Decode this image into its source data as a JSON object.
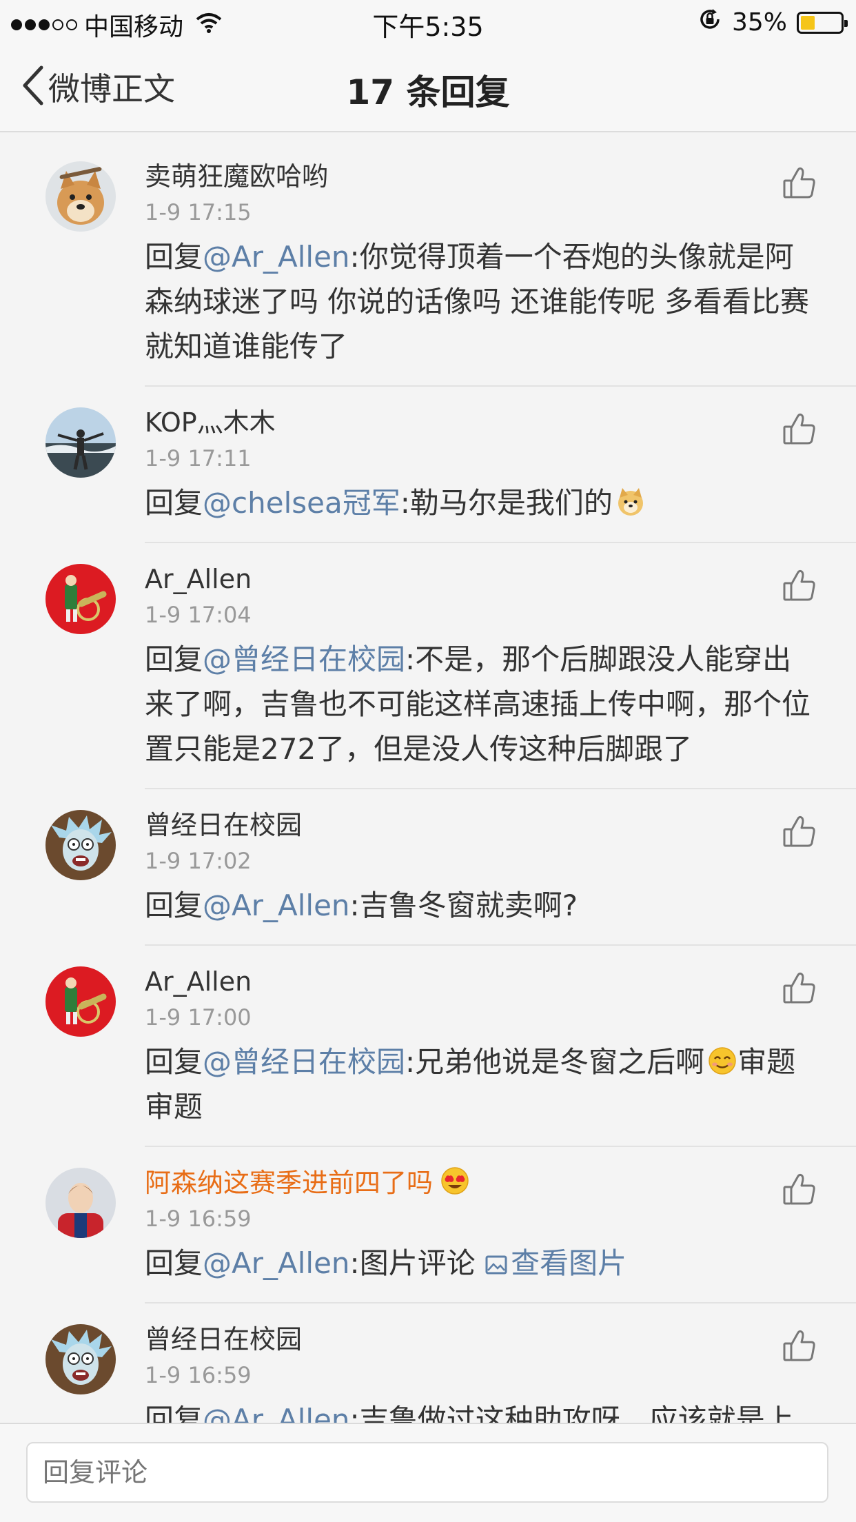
{
  "status_bar": {
    "carrier": "中国移动",
    "time": "下午5:35",
    "battery_text": "35%",
    "battery_level": 0.35,
    "battery_color": "#f5c518",
    "signal_bars_filled": 3,
    "signal_bars_total": 5
  },
  "nav": {
    "back_label": "微博正文",
    "title": "17 条回复"
  },
  "colors": {
    "mention": "#5d7fa7",
    "highlight_name": "#e86d16",
    "time": "#999999"
  },
  "comments": [
    {
      "user": "卖萌狂魔欧哈哟",
      "time": "1-9 17:15",
      "prefix": "回复",
      "mention": "@Ar_Allen",
      "text": ":你觉得顶着一个吞炮的头像就是阿森纳球迷了吗 你说的话像吗 还谁能传呢 多看看比赛就知道谁能传了",
      "avatar": "dog-avatar"
    },
    {
      "user": "KOP灬木木",
      "time": "1-9 17:11",
      "prefix": "回复",
      "mention": "@chelsea冠军",
      "text": ":勒马尔是我们的",
      "avatar": "beach-person-avatar",
      "emoji": "doge-emoji"
    },
    {
      "user": "Ar_Allen",
      "time": "1-9 17:04",
      "prefix": "回复",
      "mention": "@曾经日在校园",
      "text": ":不是，那个后脚跟没人能穿出来了啊，吉鲁也不可能这样高速插上传中啊，那个位置只能是272了，但是没人传这种后脚跟了",
      "avatar": "arsenal-cannon-avatar"
    },
    {
      "user": "曾经日在校园",
      "time": "1-9 17:02",
      "prefix": "回复",
      "mention": "@Ar_Allen",
      "text": ":吉鲁冬窗就卖啊?",
      "avatar": "rick-avatar"
    },
    {
      "user": "Ar_Allen",
      "time": "1-9 17:00",
      "prefix": "回复",
      "mention": "@曾经日在校园",
      "text": ":兄弟他说是冬窗之后啊",
      "emoji": "smile-emoji",
      "text_after": "审题审题",
      "avatar": "arsenal-cannon-avatar"
    },
    {
      "user": "阿森纳这赛季进前四了吗",
      "time": "1-9 16:59",
      "prefix": "回复",
      "mention": "@Ar_Allen",
      "text": ":图片评论 ",
      "link_text": "查看图片",
      "avatar": "player-avatar",
      "name_emoji": "heart-eyes-emoji",
      "highlight": true
    },
    {
      "user": "曾经日在校园",
      "time": "1-9 16:59",
      "prefix": "回复",
      "mention": "@Ar_Allen",
      "text": ":吉鲁做过这种助攻呀，应该就是上赛季。",
      "avatar": "rick-avatar"
    }
  ],
  "reply_bar": {
    "placeholder": "回复评论"
  }
}
